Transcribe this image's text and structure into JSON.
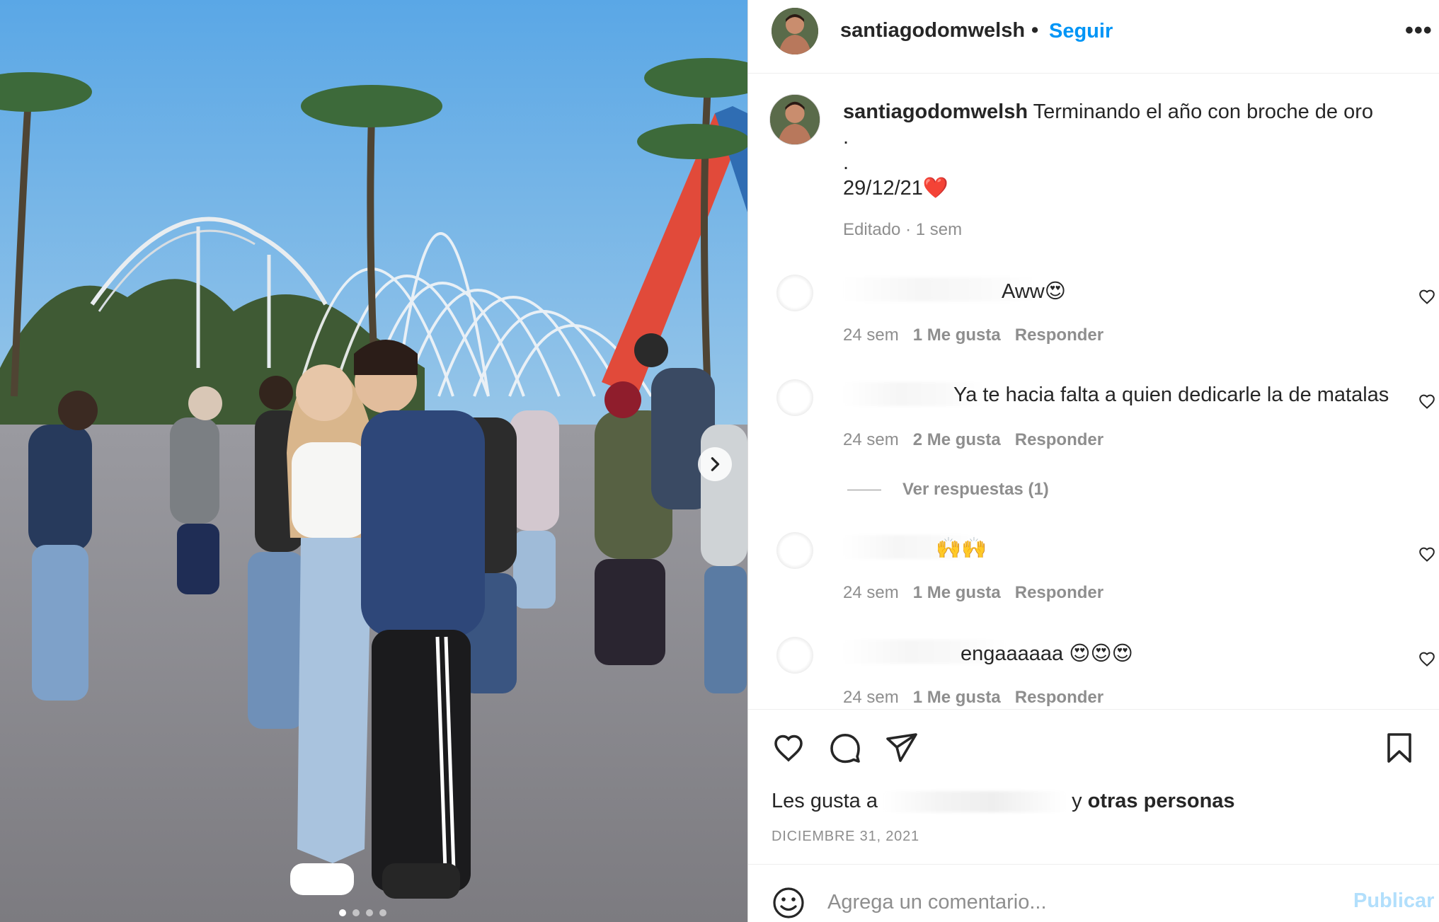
{
  "post": {
    "username": "santiagodomwelsh",
    "separator": "•",
    "follow_label": "Seguir",
    "more_label": "•••"
  },
  "caption": {
    "username": "santiagodomwelsh",
    "lines": [
      "Terminando el año con broche de oro",
      ".",
      ".",
      "29/12/21❤️"
    ],
    "meta": "Editado · 1 sem"
  },
  "comments": [
    {
      "text": "Aww😍",
      "time": "24 sem",
      "likes": "1 Me gusta",
      "reply": "Responder"
    },
    {
      "text": "Ya te hacia falta a quien dedicarle la de matalas",
      "time": "24 sem",
      "likes": "2 Me gusta",
      "reply": "Responder"
    },
    {
      "text": "🙌🙌",
      "time": "24 sem",
      "likes": "1 Me gusta",
      "reply": "Responder"
    },
    {
      "text": "engaaaaaa 😍😍😍",
      "time": "24 sem",
      "likes": "1 Me gusta",
      "reply": "Responder"
    }
  ],
  "view_replies": "Ver respuestas (1)",
  "likes": {
    "prefix": "Les gusta a",
    "suffix": "y",
    "others": "otras personas"
  },
  "date": "DICIEMBRE 31, 2021",
  "add_comment": {
    "placeholder": "Agrega un comentario...",
    "publish": "Publicar"
  },
  "carousel": {
    "total": 4,
    "active": 1
  },
  "colors": {
    "accent": "#0095f6",
    "accent_disabled": "#b2dffc",
    "muted": "#8e8e8e",
    "text": "#262626",
    "divider": "#efefef"
  },
  "icons": [
    "heart-icon",
    "comment-icon",
    "share-icon",
    "bookmark-icon",
    "emoji-icon",
    "chevron-right-icon",
    "more-icon"
  ]
}
